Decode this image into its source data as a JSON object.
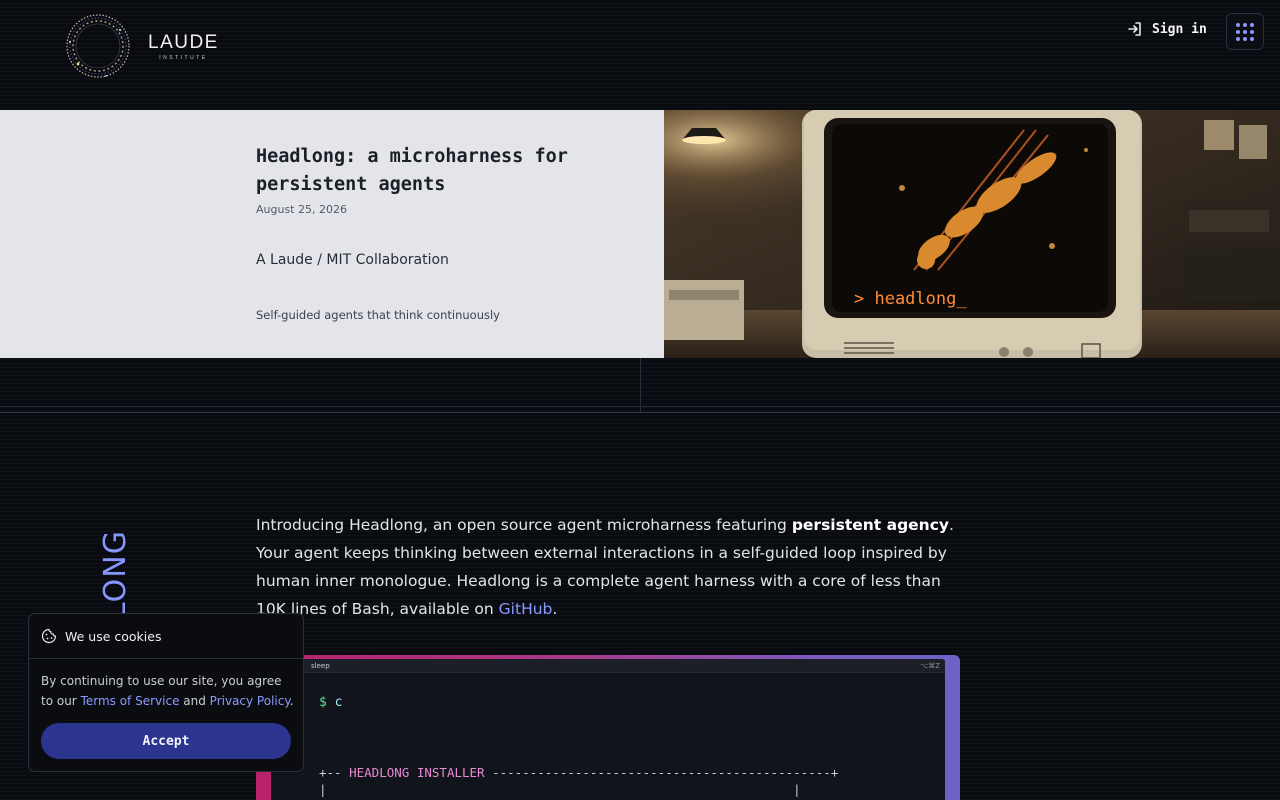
{
  "header": {
    "logo_word": "LAUDE",
    "logo_sub": "INSTITUTE",
    "signin_label": "Sign in",
    "accent_color": "#8f93ff"
  },
  "hero": {
    "title": "Headlong: a microharness for persistent agents",
    "date": "August 25, 2026",
    "collaboration": "A Laude / MIT Collaboration",
    "tagline": "Self-guided agents that think continuously",
    "image_screen_text": "> headlong_"
  },
  "side_word": "HEADLONG",
  "intro": {
    "part1": "Introducing Headlong, an open source agent microharness featuring ",
    "bold": "persistent agency",
    "part2": ". Your agent keeps thinking between external interactions in a self-guided loop inspired by human inner monologue. Headlong is a complete agent harness with a core of less than 10K lines of Bash, available on ",
    "link": "GitHub",
    "part3": "."
  },
  "terminal": {
    "title": "sleep",
    "hint": "⌥⌘Z",
    "prompt": "$",
    "command": "c",
    "installer_left": "+-- ",
    "installer_label": "HEADLONG INSTALLER",
    "installer_right": " ---------------------------------------------+",
    "line2": "|                                                              |"
  },
  "cookie": {
    "title": "We use cookies",
    "text_before": "By continuing to use our site, you agree to our ",
    "terms": "Terms of Service",
    "and": " and ",
    "privacy": "Privacy Policy",
    "end": ".",
    "accept_label": "Accept"
  }
}
